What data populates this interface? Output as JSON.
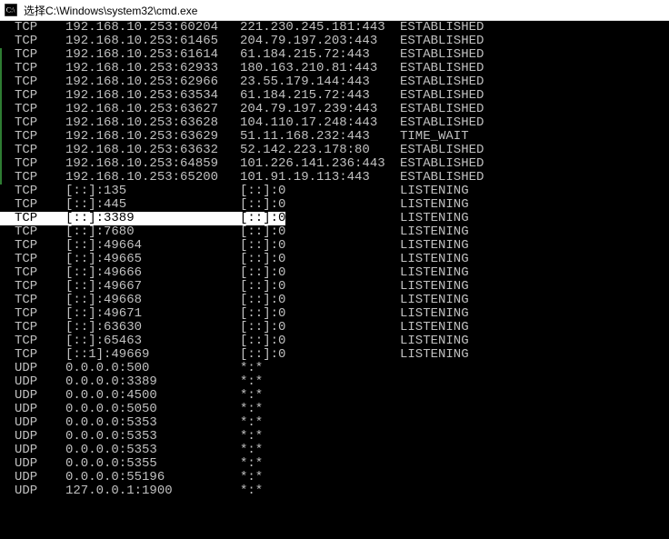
{
  "title": "选择C:\\Windows\\system32\\cmd.exe",
  "icon_name": "cmd-icon",
  "highlight_index": 13,
  "accent_stripes": [
    [
      2,
      11
    ]
  ],
  "rows": [
    {
      "proto": "TCP",
      "local": "192.168.10.253:60204",
      "remote": "221.230.245.181:443",
      "state": "ESTABLISHED"
    },
    {
      "proto": "TCP",
      "local": "192.168.10.253:61465",
      "remote": "204.79.197.203:443",
      "state": "ESTABLISHED"
    },
    {
      "proto": "TCP",
      "local": "192.168.10.253:61614",
      "remote": "61.184.215.72:443",
      "state": "ESTABLISHED"
    },
    {
      "proto": "TCP",
      "local": "192.168.10.253:62933",
      "remote": "180.163.210.81:443",
      "state": "ESTABLISHED"
    },
    {
      "proto": "TCP",
      "local": "192.168.10.253:62966",
      "remote": "23.55.179.144:443",
      "state": "ESTABLISHED"
    },
    {
      "proto": "TCP",
      "local": "192.168.10.253:63534",
      "remote": "61.184.215.72:443",
      "state": "ESTABLISHED"
    },
    {
      "proto": "TCP",
      "local": "192.168.10.253:63627",
      "remote": "204.79.197.239:443",
      "state": "ESTABLISHED"
    },
    {
      "proto": "TCP",
      "local": "192.168.10.253:63628",
      "remote": "104.110.17.248:443",
      "state": "ESTABLISHED"
    },
    {
      "proto": "TCP",
      "local": "192.168.10.253:63629",
      "remote": "51.11.168.232:443",
      "state": "TIME_WAIT"
    },
    {
      "proto": "TCP",
      "local": "192.168.10.253:63632",
      "remote": "52.142.223.178:80",
      "state": "ESTABLISHED"
    },
    {
      "proto": "TCP",
      "local": "192.168.10.253:64859",
      "remote": "101.226.141.236:443",
      "state": "ESTABLISHED"
    },
    {
      "proto": "TCP",
      "local": "192.168.10.253:65200",
      "remote": "101.91.19.113:443",
      "state": "ESTABLISHED"
    },
    {
      "proto": "TCP",
      "local": "[::]:135",
      "remote": "[::]:0",
      "state": "LISTENING"
    },
    {
      "proto": "TCP",
      "local": "[::]:445",
      "remote": "[::]:0",
      "state": "LISTENING"
    },
    {
      "proto": "TCP",
      "local": "[::]:3389",
      "remote": "[::]:0",
      "state": "LISTENING"
    },
    {
      "proto": "TCP",
      "local": "[::]:7680",
      "remote": "[::]:0",
      "state": "LISTENING"
    },
    {
      "proto": "TCP",
      "local": "[::]:49664",
      "remote": "[::]:0",
      "state": "LISTENING"
    },
    {
      "proto": "TCP",
      "local": "[::]:49665",
      "remote": "[::]:0",
      "state": "LISTENING"
    },
    {
      "proto": "TCP",
      "local": "[::]:49666",
      "remote": "[::]:0",
      "state": "LISTENING"
    },
    {
      "proto": "TCP",
      "local": "[::]:49667",
      "remote": "[::]:0",
      "state": "LISTENING"
    },
    {
      "proto": "TCP",
      "local": "[::]:49668",
      "remote": "[::]:0",
      "state": "LISTENING"
    },
    {
      "proto": "TCP",
      "local": "[::]:49671",
      "remote": "[::]:0",
      "state": "LISTENING"
    },
    {
      "proto": "TCP",
      "local": "[::]:63630",
      "remote": "[::]:0",
      "state": "LISTENING"
    },
    {
      "proto": "TCP",
      "local": "[::]:65463",
      "remote": "[::]:0",
      "state": "LISTENING"
    },
    {
      "proto": "TCP",
      "local": "[::1]:49669",
      "remote": "[::]:0",
      "state": "LISTENING"
    },
    {
      "proto": "UDP",
      "local": "0.0.0.0:500",
      "remote": "*:*",
      "state": ""
    },
    {
      "proto": "UDP",
      "local": "0.0.0.0:3389",
      "remote": "*:*",
      "state": ""
    },
    {
      "proto": "UDP",
      "local": "0.0.0.0:4500",
      "remote": "*:*",
      "state": ""
    },
    {
      "proto": "UDP",
      "local": "0.0.0.0:5050",
      "remote": "*:*",
      "state": ""
    },
    {
      "proto": "UDP",
      "local": "0.0.0.0:5353",
      "remote": "*:*",
      "state": ""
    },
    {
      "proto": "UDP",
      "local": "0.0.0.0:5353",
      "remote": "*:*",
      "state": ""
    },
    {
      "proto": "UDP",
      "local": "0.0.0.0:5353",
      "remote": "*:*",
      "state": ""
    },
    {
      "proto": "UDP",
      "local": "0.0.0.0:5355",
      "remote": "*:*",
      "state": ""
    },
    {
      "proto": "UDP",
      "local": "0.0.0.0:55196",
      "remote": "*:*",
      "state": ""
    },
    {
      "proto": "UDP",
      "local": "127.0.0.1:1900",
      "remote": "*:*",
      "state": ""
    }
  ]
}
